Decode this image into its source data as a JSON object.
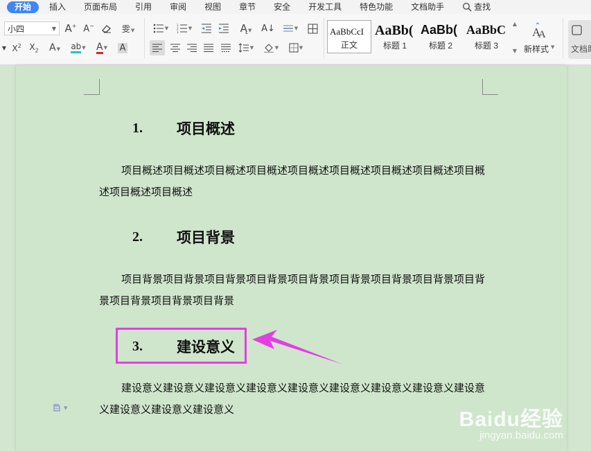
{
  "menu": {
    "tabs": [
      "开始",
      "插入",
      "页面布局",
      "引用",
      "审阅",
      "视图",
      "章节",
      "安全",
      "开发工具",
      "特色功能",
      "文档助手"
    ],
    "active_tab": "开始",
    "search_label": "查找"
  },
  "ribbon": {
    "font_size": "小四",
    "styles": [
      {
        "sample": "AaBbCcI",
        "name": "正文"
      },
      {
        "sample": "AaBb(",
        "name": "标题 1"
      },
      {
        "sample": "AaBb(",
        "name": "标题 2"
      },
      {
        "sample": "AaBbC",
        "name": "标题 3"
      }
    ],
    "new_style_label": "新样式",
    "text_tools_label": "文档助"
  },
  "document": {
    "sections": [
      {
        "number": "1.",
        "title": "项目概述",
        "body": "项目概述项目概述项目概述项目概述项目概述项目概述项目概述项目概述项目概述项目概述项目概述"
      },
      {
        "number": "2.",
        "title": "项目背景",
        "body": "项目背景项目背景项目背景项目背景项目背景项目背景项目背景项目背景项目背景项目背景项目背景项目背景"
      },
      {
        "number": "3.",
        "title": "建设意义",
        "body": "建设意义建设意义建设意义建设意义建设意义建设意义建设意义建设意义建设意义建设意义建设意义建设意义"
      }
    ]
  },
  "watermark": {
    "brand": "Baidu经验",
    "url": "jingyan.baidu.com"
  },
  "colors": {
    "page_background": "#cfe6cc",
    "active_tab": "#3f86f5",
    "highlight": "#e23fe2"
  }
}
